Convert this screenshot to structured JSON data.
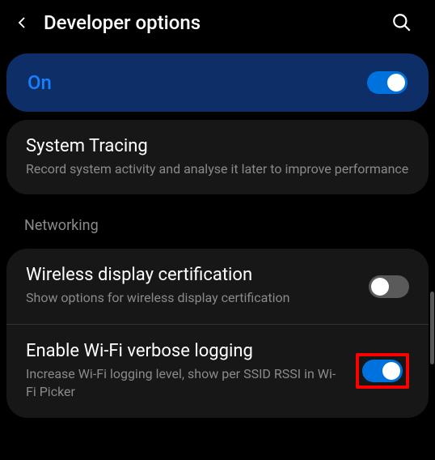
{
  "header": {
    "title": "Developer options"
  },
  "main_toggle": {
    "label": "On",
    "state": "on"
  },
  "system_tracing": {
    "title": "System Tracing",
    "description": "Record system activity and analyse it later to improve performance"
  },
  "networking": {
    "section_label": "Networking",
    "wireless_display": {
      "title": "Wireless display certification",
      "description": "Show options for wireless display certification",
      "state": "off"
    },
    "wifi_verbose": {
      "title": "Enable Wi-Fi verbose logging",
      "description": "Increase Wi-Fi logging level, show per SSID RSSI in Wi-Fi Picker",
      "state": "on"
    }
  }
}
